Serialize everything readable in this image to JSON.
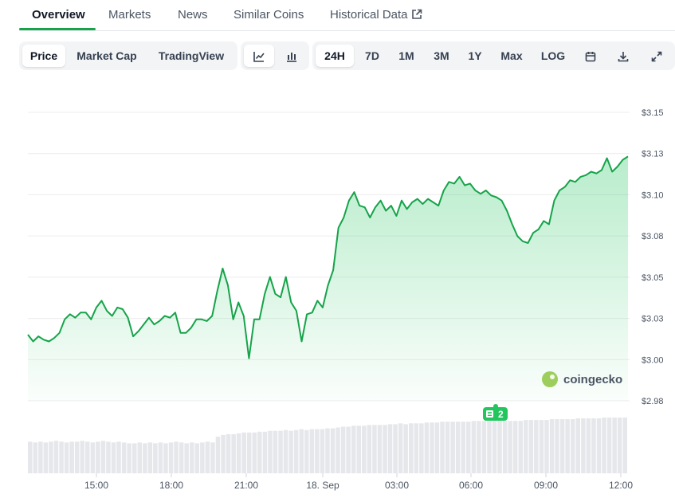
{
  "tabs": [
    {
      "label": "Overview",
      "active": true
    },
    {
      "label": "Markets"
    },
    {
      "label": "News"
    },
    {
      "label": "Similar Coins"
    },
    {
      "label": "Historical Data",
      "icon": "external-link-icon"
    }
  ],
  "toolbar": {
    "view_options": [
      "Price",
      "Market Cap",
      "TradingView"
    ],
    "view_selected": "Price",
    "chart_types": [
      {
        "icon": "line-chart-icon",
        "selected": true
      },
      {
        "icon": "candlestick-icon"
      }
    ],
    "ranges": [
      "24H",
      "7D",
      "1M",
      "3M",
      "1Y",
      "Max",
      "LOG"
    ],
    "range_selected": "24H",
    "actions": [
      {
        "icon": "calendar-icon"
      },
      {
        "icon": "download-icon"
      },
      {
        "icon": "fullscreen-icon"
      }
    ]
  },
  "watermark": "coingecko",
  "event_badge": {
    "count": "2",
    "icon": "news-icon",
    "color": "#22c55e"
  },
  "colors": {
    "line": "#16a34a",
    "fill": "#22c55e",
    "volume": "#e5e7eb",
    "grid": "#ececec"
  },
  "chart_data": {
    "type": "area",
    "title": "",
    "ylim": [
      2.98,
      3.15
    ],
    "ytick_labels": [
      "$3.15",
      "$3.13",
      "$3.10",
      "$3.08",
      "$3.05",
      "$3.03",
      "$3.00",
      "$2.98"
    ],
    "xtick_labels": [
      "15:00",
      "18:00",
      "21:00",
      "18. Sep",
      "03:00",
      "06:00",
      "09:00",
      "12:00"
    ],
    "grid": true,
    "series": [
      {
        "points": [
          [
            0,
            3.019
          ],
          [
            1,
            3.015
          ],
          [
            2,
            3.018
          ],
          [
            3,
            3.016
          ],
          [
            4,
            3.015
          ],
          [
            5,
            3.017
          ],
          [
            6,
            3.02
          ],
          [
            7,
            3.028
          ],
          [
            8,
            3.031
          ],
          [
            9,
            3.029
          ],
          [
            10,
            3.032
          ],
          [
            11,
            3.032
          ],
          [
            12,
            3.028
          ],
          [
            13,
            3.035
          ],
          [
            14,
            3.039
          ],
          [
            15,
            3.033
          ],
          [
            16,
            3.03
          ],
          [
            17,
            3.035
          ],
          [
            18,
            3.034
          ],
          [
            19,
            3.029
          ],
          [
            20,
            3.018
          ],
          [
            21,
            3.021
          ],
          [
            22,
            3.025
          ],
          [
            23,
            3.029
          ],
          [
            24,
            3.025
          ],
          [
            25,
            3.027
          ],
          [
            26,
            3.03
          ],
          [
            27,
            3.029
          ],
          [
            28,
            3.032
          ],
          [
            29,
            3.02
          ],
          [
            30,
            3.02
          ],
          [
            31,
            3.023
          ],
          [
            32,
            3.028
          ],
          [
            33,
            3.028
          ],
          [
            34,
            3.027
          ],
          [
            35,
            3.03
          ],
          [
            36,
            3.045
          ],
          [
            37,
            3.058
          ],
          [
            38,
            3.048
          ],
          [
            39,
            3.028
          ],
          [
            40,
            3.038
          ],
          [
            41,
            3.03
          ],
          [
            42,
            3.005
          ],
          [
            43,
            3.028
          ],
          [
            44,
            3.028
          ],
          [
            45,
            3.043
          ],
          [
            46,
            3.053
          ],
          [
            47,
            3.043
          ],
          [
            48,
            3.041
          ],
          [
            49,
            3.053
          ],
          [
            50,
            3.038
          ],
          [
            51,
            3.033
          ],
          [
            52,
            3.015
          ],
          [
            53,
            3.031
          ],
          [
            54,
            3.032
          ],
          [
            55,
            3.039
          ],
          [
            56,
            3.035
          ],
          [
            57,
            3.048
          ],
          [
            58,
            3.057
          ],
          [
            59,
            3.082
          ],
          [
            60,
            3.088
          ],
          [
            61,
            3.098
          ],
          [
            62,
            3.103
          ],
          [
            63,
            3.095
          ],
          [
            64,
            3.094
          ],
          [
            65,
            3.088
          ],
          [
            66,
            3.094
          ],
          [
            67,
            3.098
          ],
          [
            68,
            3.092
          ],
          [
            69,
            3.095
          ],
          [
            70,
            3.089
          ],
          [
            71,
            3.098
          ],
          [
            72,
            3.093
          ],
          [
            73,
            3.097
          ],
          [
            74,
            3.099
          ],
          [
            75,
            3.096
          ],
          [
            76,
            3.099
          ],
          [
            77,
            3.097
          ],
          [
            78,
            3.095
          ],
          [
            79,
            3.104
          ],
          [
            80,
            3.109
          ],
          [
            81,
            3.108
          ],
          [
            82,
            3.112
          ],
          [
            83,
            3.107
          ],
          [
            84,
            3.108
          ],
          [
            85,
            3.104
          ],
          [
            86,
            3.102
          ],
          [
            87,
            3.104
          ],
          [
            88,
            3.101
          ],
          [
            89,
            3.1
          ],
          [
            90,
            3.098
          ],
          [
            91,
            3.092
          ],
          [
            92,
            3.084
          ],
          [
            93,
            3.077
          ],
          [
            94,
            3.074
          ],
          [
            95,
            3.073
          ],
          [
            96,
            3.079
          ],
          [
            97,
            3.081
          ],
          [
            98,
            3.086
          ],
          [
            99,
            3.084
          ],
          [
            100,
            3.098
          ],
          [
            101,
            3.104
          ],
          [
            102,
            3.106
          ],
          [
            103,
            3.11
          ],
          [
            104,
            3.109
          ],
          [
            105,
            3.112
          ],
          [
            106,
            3.113
          ],
          [
            107,
            3.115
          ],
          [
            108,
            3.114
          ],
          [
            109,
            3.116
          ],
          [
            110,
            3.123
          ],
          [
            111,
            3.115
          ],
          [
            112,
            3.118
          ],
          [
            113,
            3.122
          ],
          [
            114,
            3.124
          ]
        ]
      }
    ],
    "volume": [
      38,
      37,
      38,
      37,
      38,
      39,
      38,
      37,
      38,
      38,
      39,
      38,
      37,
      38,
      39,
      38,
      37,
      38,
      37,
      36,
      36,
      37,
      36,
      37,
      36,
      37,
      36,
      37,
      38,
      37,
      36,
      37,
      36,
      37,
      38,
      37,
      44,
      46,
      47,
      47,
      48,
      49,
      49,
      49,
      50,
      50,
      51,
      51,
      51,
      52,
      51,
      52,
      53,
      52,
      53,
      53,
      53,
      54,
      54,
      55,
      56,
      56,
      57,
      57,
      57,
      58,
      58,
      58,
      58,
      59,
      59,
      60,
      59,
      60,
      60,
      60,
      61,
      61,
      61,
      62,
      62,
      62,
      62,
      62,
      62,
      63,
      63,
      63,
      63,
      63,
      63,
      63,
      63,
      63,
      63,
      64,
      64,
      64,
      64,
      64,
      65,
      65,
      65,
      65,
      65,
      66,
      66,
      66,
      66,
      66,
      67,
      67,
      67,
      67,
      67
    ]
  }
}
